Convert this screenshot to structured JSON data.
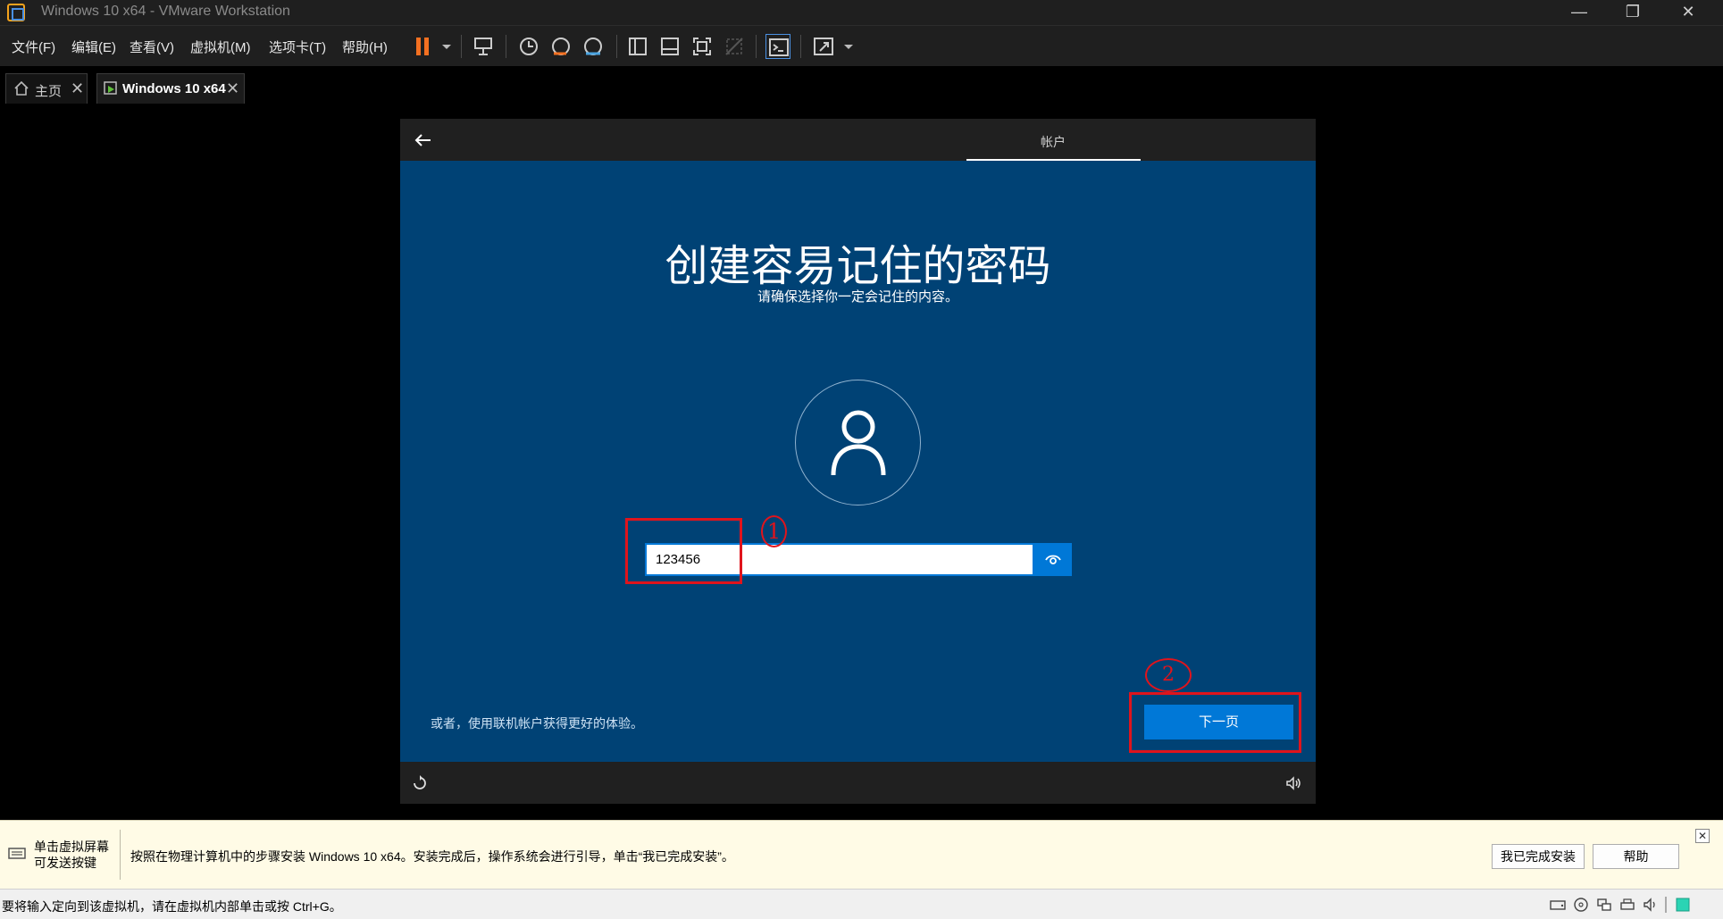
{
  "window": {
    "title": "Windows 10 x64 - VMware Workstation",
    "minimize": "—",
    "maximize": "❐",
    "close": "✕"
  },
  "menu": [
    "文件(F)",
    "编辑(E)",
    "查看(V)",
    "虚拟机(M)",
    "选项卡(T)",
    "帮助(H)"
  ],
  "tabs": [
    {
      "label": "主页",
      "close": "✕"
    },
    {
      "label": "Windows 10 x64",
      "close": "✕"
    }
  ],
  "oobe": {
    "section": "帐户",
    "title": "创建容易记住的密码",
    "subtitle": "请确保选择你一定会记住的内容。",
    "password_value": "123456",
    "online_link": "或者，使用联机帐户获得更好的体验。",
    "next_label": "下一页"
  },
  "annotations": {
    "step1": "1",
    "step2": "2"
  },
  "hint": {
    "left_line1": "单击虚拟屏幕",
    "left_line2": "可发送按键",
    "message": "按照在物理计算机中的步骤安装 Windows 10 x64。安装完成后，操作系统会进行引导，单击“我已完成安装”。",
    "done_button": "我已完成安装",
    "help_button": "帮助",
    "close": "✕"
  },
  "status": {
    "text": "要将输入定向到该虚拟机，请在虚拟机内部单击或按 Ctrl+G。"
  },
  "colors": {
    "oobe_background": "#004275",
    "accent": "#0078d7",
    "annotation": "#e0141c",
    "toolbar_pause": "#f37021"
  }
}
